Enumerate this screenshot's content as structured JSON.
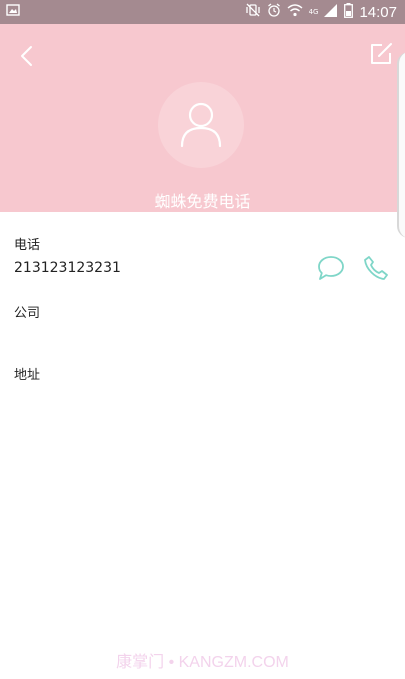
{
  "status_bar": {
    "time": "14:07",
    "network_label": "4G",
    "icons": [
      "screenshot-icon",
      "vibrate-off-icon",
      "alarm-icon",
      "wifi-icon",
      "signal-icon",
      "battery-icon"
    ]
  },
  "header": {
    "background_color": "#f7c8cf",
    "contact_name": "蜘蛛免费电话",
    "icons": [
      "back-arrow-icon",
      "edit-icon",
      "person-icon"
    ]
  },
  "fields": {
    "phone": {
      "label": "电话",
      "value": "213123123231",
      "actions": [
        "message-icon",
        "phone-call-icon"
      ],
      "accent_color": "#7fd6c8"
    },
    "company": {
      "label": "公司",
      "value": ""
    },
    "address": {
      "label": "地址",
      "value": ""
    }
  },
  "watermark": "康掌门 • KANGZM.COM"
}
